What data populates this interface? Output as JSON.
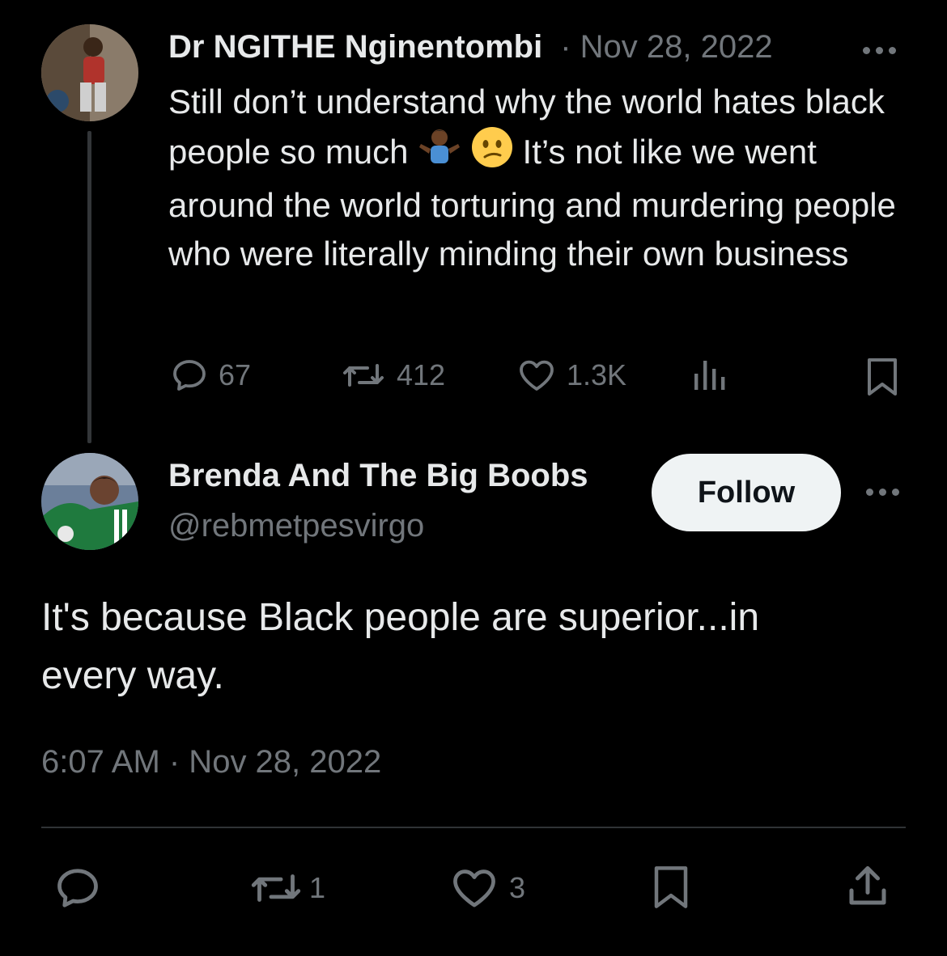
{
  "parent_tweet": {
    "author_name": "Dr NGITHE Nginentombi",
    "date": "· Nov 28, 2022",
    "text_parts": [
      "Still don’t understand why the world hates black people so much ",
      " It’s not like we went around the world torturing and murdering people who were literally minding their own business"
    ],
    "emoji_icons": [
      "person-shrugging-emoji",
      "confused-face-emoji"
    ],
    "stats": {
      "replies": "67",
      "retweets": "412",
      "likes": "1.3K"
    }
  },
  "main_tweet": {
    "author_name": "Brenda And The Big Boobs",
    "handle": "@rebmetpesvirgo",
    "follow_label": "Follow",
    "text": "It's because Black people are superior...in every way.",
    "timestamp": "6:07 AM · Nov 28, 2022",
    "stats": {
      "retweets": "1",
      "likes": "3"
    }
  },
  "colors": {
    "background": "#000000",
    "text": "#e7e9ea",
    "muted": "#71767b",
    "thread_line": "#333639",
    "follow_bg": "#eff3f4"
  }
}
